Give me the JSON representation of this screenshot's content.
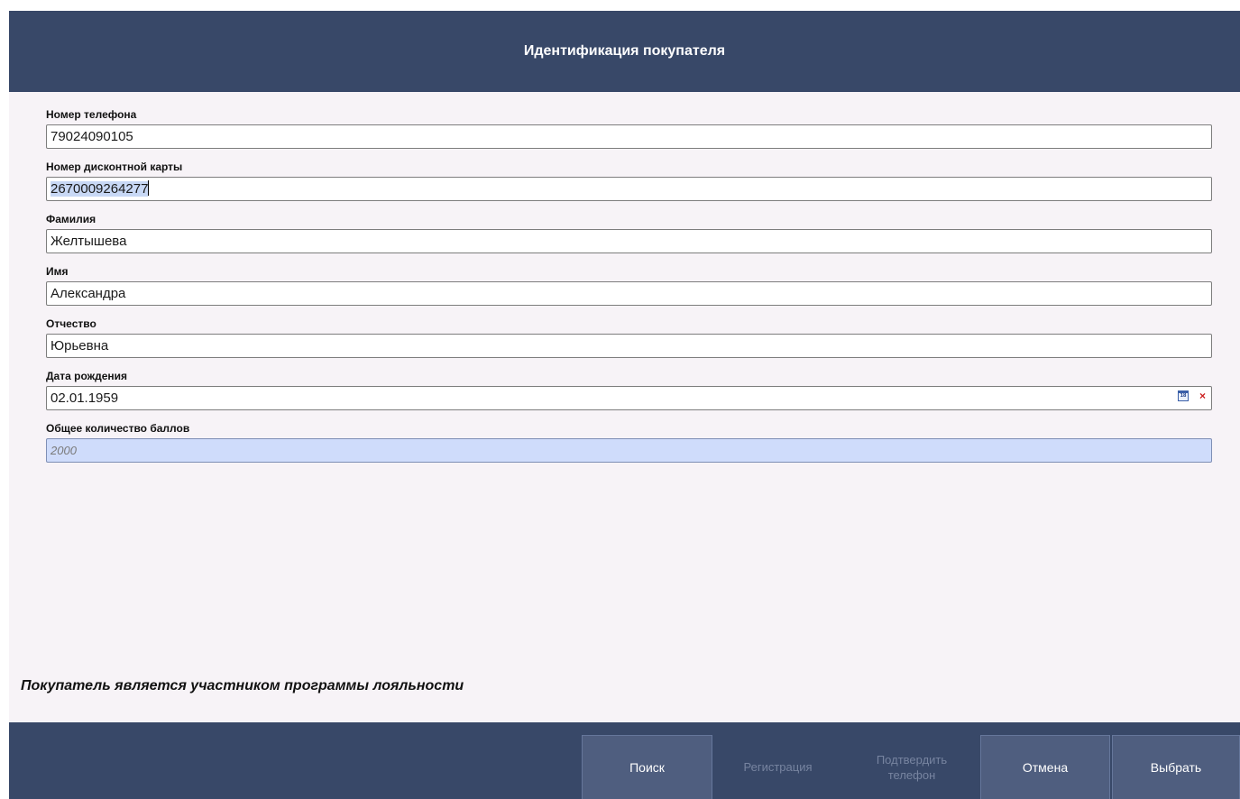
{
  "dialog": {
    "title": "Идентификация покупателя"
  },
  "fields": {
    "phone": {
      "label": "Номер телефона",
      "value": "79024090105"
    },
    "card": {
      "label": "Номер дисконтной карты",
      "value": "2670009264277"
    },
    "surname": {
      "label": "Фамилия",
      "value": "Желтышева"
    },
    "name": {
      "label": "Имя",
      "value": "Александра"
    },
    "patronymic": {
      "label": "Отчество",
      "value": "Юрьевна"
    },
    "birthdate": {
      "label": "Дата рождения",
      "value": "02.01.1959",
      "calendar_icon_text": "18",
      "clear_icon_text": "×"
    },
    "points": {
      "label": "Общее количество баллов",
      "value": "2000"
    }
  },
  "status": {
    "message": "Покупатель является участником программы лояльности"
  },
  "footer": {
    "search_label": "Поиск",
    "register_label": "Регистрация",
    "confirm_phone_label_line1": "Подтвердить",
    "confirm_phone_label_line2": "телефон",
    "cancel_label": "Отмена",
    "select_label": "Выбрать"
  },
  "colors": {
    "header_bg": "#384868",
    "body_bg": "#f7f3f7",
    "readonly_field_bg": "#cfdcfb",
    "button_active_bg": "#4f5e7f",
    "button_disabled_text": "#7784a0"
  }
}
